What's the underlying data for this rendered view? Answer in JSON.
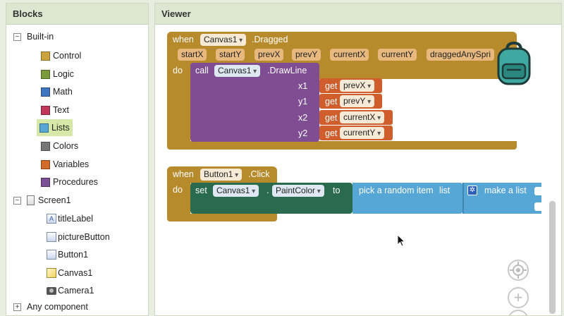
{
  "blocks_panel": {
    "title": "Blocks",
    "builtin_label": "Built-in",
    "builtin_toggle": "−",
    "builtin_items": [
      {
        "label": "Control",
        "color": "#c9a33c"
      },
      {
        "label": "Logic",
        "color": "#7a9a3c"
      },
      {
        "label": "Math",
        "color": "#3f76c1"
      },
      {
        "label": "Text",
        "color": "#c2355b"
      },
      {
        "label": "Lists",
        "color": "#56a6d6"
      },
      {
        "label": "Colors",
        "color": "#777777"
      },
      {
        "label": "Variables",
        "color": "#d36a2a"
      },
      {
        "label": "Procedures",
        "color": "#7b4f96"
      }
    ],
    "screen_label": "Screen1",
    "screen_toggle": "−",
    "components": [
      {
        "label": "titleLabel",
        "icon": "label-icon"
      },
      {
        "label": "pictureButton",
        "icon": "button-icon"
      },
      {
        "label": "Button1",
        "icon": "button-icon"
      },
      {
        "label": "Canvas1",
        "icon": "canvas-icon"
      },
      {
        "label": "Camera1",
        "icon": "camera-icon"
      }
    ],
    "any_component_label": "Any component",
    "any_component_toggle": "+"
  },
  "viewer": {
    "title": "Viewer",
    "drag_block": {
      "when": "when",
      "component": "Canvas1",
      "event": ".Dragged",
      "params": [
        "startX",
        "startY",
        "prevX",
        "prevY",
        "currentX",
        "currentY",
        "draggedAnySpri"
      ],
      "do": "do",
      "call": "call",
      "call_component": "Canvas1",
      "method": ".DrawLine",
      "args": [
        {
          "name": "x1",
          "get": "get",
          "var": "prevX"
        },
        {
          "name": "y1",
          "get": "get",
          "var": "prevY"
        },
        {
          "name": "x2",
          "get": "get",
          "var": "currentX"
        },
        {
          "name": "y2",
          "get": "get",
          "var": "currentY"
        }
      ]
    },
    "click_block": {
      "when": "when",
      "component": "Button1",
      "event": ".Click",
      "do": "do",
      "set": "set",
      "set_component": "Canvas1",
      "dot": ".",
      "property": "PaintColor",
      "to": "to",
      "pick": "pick a random item",
      "list": "list",
      "make": "make a list"
    }
  }
}
